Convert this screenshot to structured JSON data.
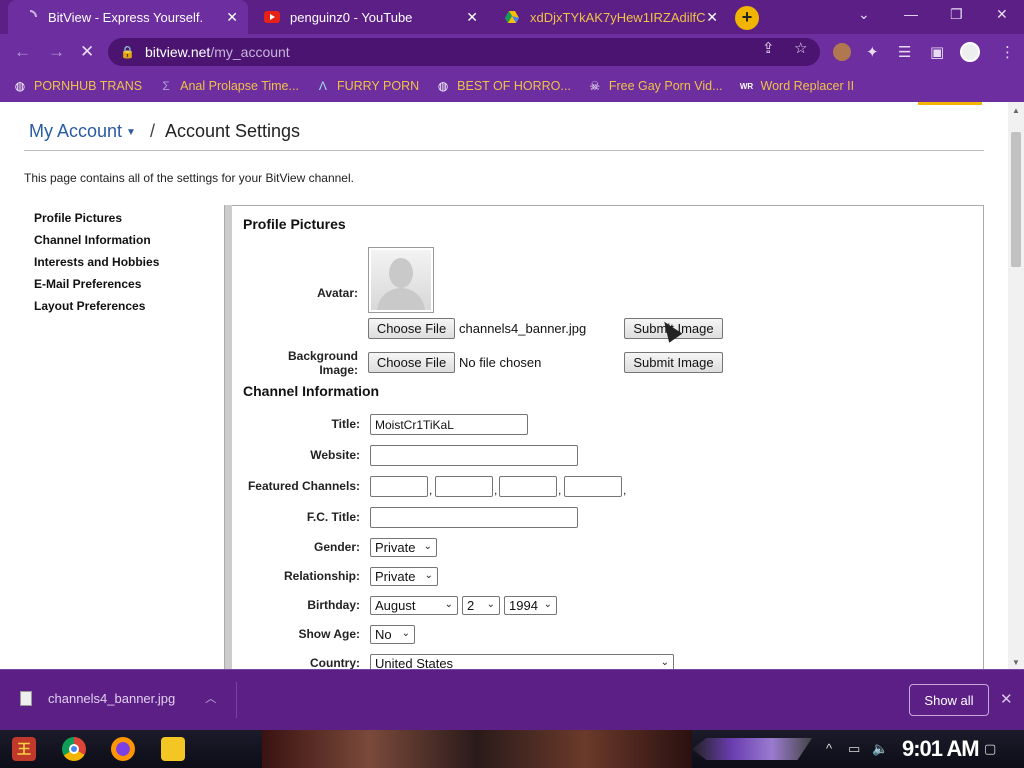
{
  "browser": {
    "tabs": [
      {
        "title": "BitView - Express Yourself.",
        "active": true,
        "favicon": "loading-spinner-icon"
      },
      {
        "title": "penguinz0 - YouTube",
        "active": false,
        "favicon": "youtube-icon"
      },
      {
        "title": "xdDjxTYkAK7yHew1IRZAdilfC",
        "active": false,
        "favicon": "drive-icon"
      }
    ],
    "url_host": "bitview.net",
    "url_path": "/my_account",
    "bookmarks": [
      {
        "label": "PORNHUB TRANS",
        "icon": "globe-icon"
      },
      {
        "label": "Anal Prolapse Time...",
        "icon": "sigma-icon"
      },
      {
        "label": "FURRY PORN",
        "icon": "lambda-icon"
      },
      {
        "label": "BEST OF HORRO...",
        "icon": "globe-icon"
      },
      {
        "label": "Free Gay Porn Vid...",
        "icon": "skull-icon"
      },
      {
        "label": "Word Replacer II",
        "icon": "wr-extension-icon"
      }
    ]
  },
  "page": {
    "breadcrumb_root": "My Account",
    "breadcrumb_sep": "/",
    "breadcrumb_current": "Account Settings",
    "description": "This page contains all of the settings for your BitView channel.",
    "sidenav": [
      "Profile Pictures",
      "Channel Information",
      "Interests and Hobbies",
      "E-Mail Preferences",
      "Layout Preferences"
    ],
    "profile_pictures": {
      "heading": "Profile Pictures",
      "avatar_label": "Avatar:",
      "background_label_line1": "Background",
      "background_label_line2": "Image:",
      "choose_file": "Choose File",
      "avatar_file": "channels4_banner.jpg",
      "background_file": "No file chosen",
      "submit": "Submit Image"
    },
    "channel_info": {
      "heading": "Channel Information",
      "title_label": "Title:",
      "title_value": "MoistCr1TiKaL",
      "website_label": "Website:",
      "website_value": "",
      "featured_label": "Featured Channels:",
      "fc_title_label": "F.C. Title:",
      "gender_label": "Gender:",
      "gender_value": "Private",
      "relationship_label": "Relationship:",
      "relationship_value": "Private",
      "birthday_label": "Birthday:",
      "birthday_month": "August",
      "birthday_day": "2",
      "birthday_year": "1994",
      "show_age_label": "Show Age:",
      "show_age_value": "No",
      "country_label": "Country:",
      "country_value": "United States"
    }
  },
  "downloads": {
    "file": "channels4_banner.jpg",
    "show_all": "Show all"
  },
  "taskbar": {
    "clock": "9:01 AM"
  },
  "colors": {
    "chrome_dark": "#5c1f86",
    "chrome_toolbar": "#6d2ea0",
    "bookmark_text": "#f0c24a",
    "link_blue": "#2a5ba3"
  }
}
